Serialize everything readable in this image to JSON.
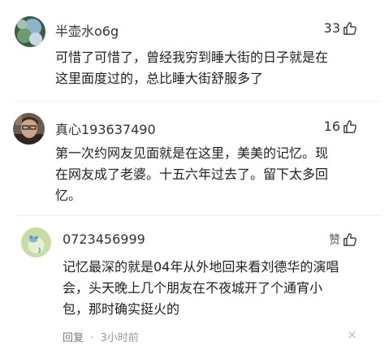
{
  "comments": [
    {
      "username": "半壶水o6g",
      "likes": "33",
      "lines": [
        "可惜了可惜了，曾经我穷到睡大街的日子就是在",
        "这里面度过的，总比睡大街舒服多了"
      ]
    },
    {
      "username": "真心193637490",
      "likes": "16",
      "lines": [
        "第一次约网友见面就是在这里，美美的记忆。现",
        "在网友成了老婆。十五六年过去了。留下太多回",
        "忆。"
      ]
    },
    {
      "username": "0723456999",
      "likes": "赞",
      "lines": [
        "记忆最深的就是04年从外地回来看刘德华的演唱",
        "会，头天晚上几个朋友在不夜城开了个通宵小",
        "包，那时确实挺火的"
      ],
      "reply_label": "回复",
      "separator": "·",
      "time": "3小时前",
      "close": "×"
    }
  ],
  "icons": {
    "like": "thumbs-up-icon",
    "close": "close-icon"
  },
  "colors": {
    "text": "#222222",
    "muted": "#999999",
    "divider": "#eeeeee"
  }
}
